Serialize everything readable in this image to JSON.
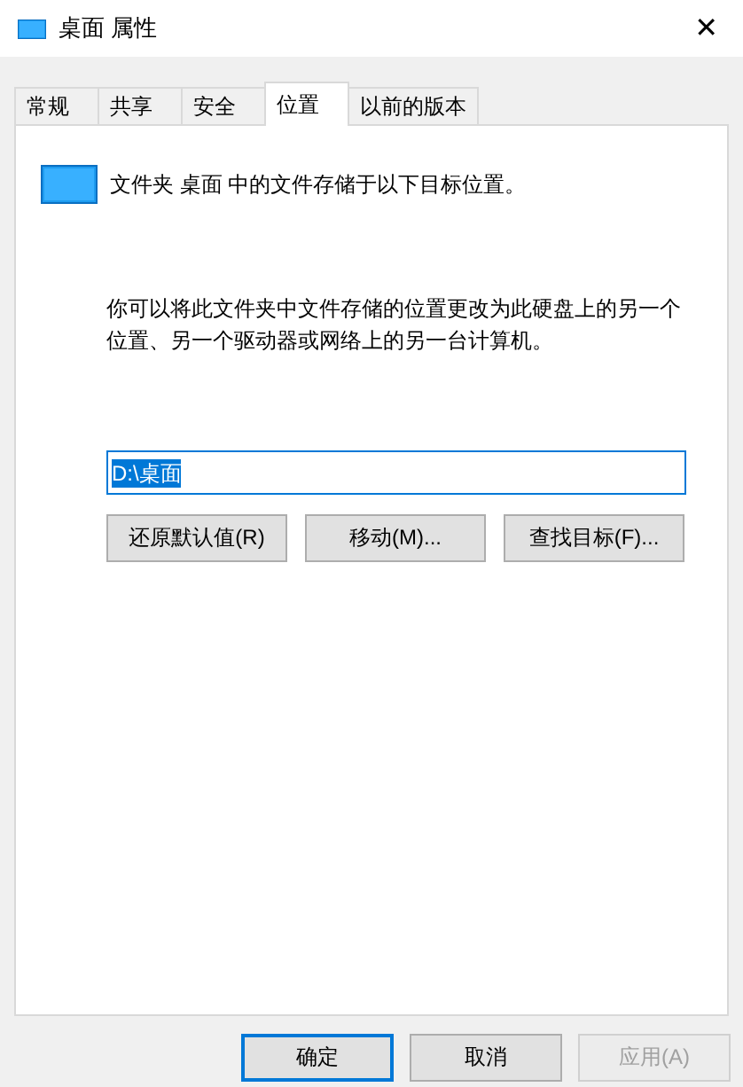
{
  "window": {
    "title": "桌面 属性",
    "close": "✕"
  },
  "tabs": [
    {
      "label": "常规",
      "selected": false
    },
    {
      "label": "共享",
      "selected": false
    },
    {
      "label": "安全",
      "selected": false
    },
    {
      "label": "位置",
      "selected": true
    },
    {
      "label": "以前的版本",
      "selected": false
    }
  ],
  "location": {
    "heading": "文件夹 桌面 中的文件存储于以下目标位置。",
    "description": "你可以将此文件夹中文件存储的位置更改为此硬盘上的另一个位置、另一个驱动器或网络上的另一台计算机。",
    "path": {
      "value": "D:\\桌面",
      "text_selected": true
    },
    "buttons": [
      {
        "label": "还原默认值(R)",
        "disabled": false
      },
      {
        "label": "移动(M)...",
        "disabled": false
      },
      {
        "label": "查找目标(F)...",
        "disabled": false
      }
    ]
  },
  "dialog_buttons": [
    {
      "label": "确定",
      "default": true,
      "disabled": false
    },
    {
      "label": "取消",
      "default": false,
      "disabled": false
    },
    {
      "label": "应用(A)",
      "default": false,
      "disabled": true
    }
  ]
}
